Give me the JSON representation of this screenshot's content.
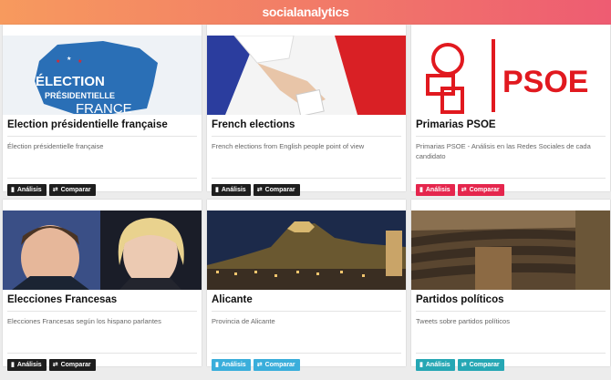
{
  "app": {
    "brand": "socialanalytics"
  },
  "cards": [
    {
      "title": "Élection présidentielle française",
      "description": "Élection présidentielle française",
      "thumb_text": [
        "ÉLECTION",
        "PRÉSIDENTIELLE",
        "FRANCE"
      ],
      "analysis_label": "Análisis",
      "compare_label": "Comparar",
      "button_color": "#1e1e1e"
    },
    {
      "title": "French elections",
      "description": "French elections from English people point of view",
      "analysis_label": "Análisis",
      "compare_label": "Comparar",
      "button_color": "#1e1e1e"
    },
    {
      "title": "Primarias PSOE",
      "description": "Primarias PSOE - Análisis en las Redes Sociales de cada candidato",
      "thumb_text": [
        "PSOE"
      ],
      "analysis_label": "Análisis",
      "compare_label": "Comparar",
      "button_color": "#e5264d"
    },
    {
      "title": "Elecciones Francesas",
      "description": "Elecciones Francesas según los hispano parlantes",
      "analysis_label": "Análisis",
      "compare_label": "Comparar",
      "button_color": "#1e1e1e"
    },
    {
      "title": "Alicante",
      "description": "Provincia de Alicante",
      "analysis_label": "Análisis",
      "compare_label": "Comparar",
      "button_color": "#3aaedb"
    },
    {
      "title": "Partidos políticos",
      "description": "Tweets sobre partidos políticos",
      "analysis_label": "Análisis",
      "compare_label": "Comparar",
      "button_color": "#26a7b4"
    }
  ],
  "icons": {
    "analysis": "bar-chart-icon",
    "compare": "compare-icon"
  }
}
